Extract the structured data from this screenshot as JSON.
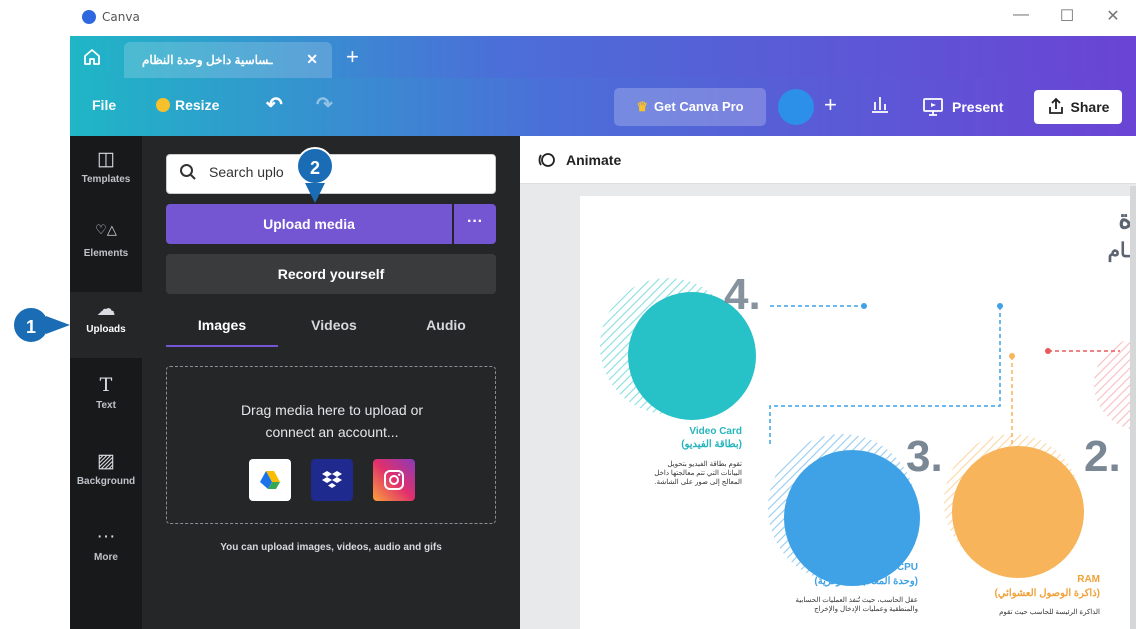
{
  "window": {
    "app_name": "Canva",
    "min": "—",
    "max": "☐",
    "close": "✕"
  },
  "tabbar": {
    "home_icon": "home-icon",
    "doc_tab_title": "ـساسية داخل وحدة النظام",
    "close": "✕",
    "new_tab": "+"
  },
  "toolbar": {
    "file": "File",
    "resize": "Resize",
    "undo": "↶",
    "redo": "↷",
    "get_pro": "Get Canva Pro",
    "add": "+",
    "insights": "ıll",
    "present_icon": "▭",
    "present": "Present",
    "share_icon": "⇧",
    "share": "Share"
  },
  "rail": {
    "items": [
      {
        "label": "Templates",
        "icon": "◫"
      },
      {
        "label": "Elements",
        "icon": "♡△"
      },
      {
        "label": "Uploads",
        "icon": "☁"
      },
      {
        "label": "Text",
        "icon": "T"
      },
      {
        "label": "Background",
        "icon": "▨"
      },
      {
        "label": "More",
        "icon": "···"
      }
    ]
  },
  "panel": {
    "search_value": "Search uplo",
    "upload_media": "Upload media",
    "upload_more": "···",
    "record": "Record yourself",
    "tabs": [
      "Images",
      "Videos",
      "Audio"
    ],
    "drop_text_1": "Drag media here to upload or",
    "drop_text_2": "connect an account...",
    "helper": "You can upload images, videos, audio and gifs",
    "services": [
      "google-drive-icon",
      "dropbox-icon",
      "instagram-icon"
    ],
    "collapse": "‹"
  },
  "canvas": {
    "animate": "Animate",
    "title_frag_1": "ة",
    "title_frag_2": "ـام",
    "items": [
      {
        "num": "4.",
        "en": "Video Card",
        "ar": "(بطاقة الفيديو)",
        "desc": "تقوم بطاقة الفيديو بتحويل البيانات التي تتم معالجتها داخل المعالج إلى صور على الشاشة."
      },
      {
        "num": "3.",
        "en": "CPU",
        "ar": "(وحدة المعالجة المركزية)",
        "desc": "عقل الحاسب، حيث تُنفذ العمليات الحسابية والمنطقية وعمليات الإدخال والإخراج"
      },
      {
        "num": "2.",
        "en": "RAM",
        "ar": "(ذاكرة الوصول العشوائي)",
        "desc": "الذاكرة الرئيسة للحاسب حيث تقوم"
      }
    ]
  },
  "annotations": [
    "1",
    "2"
  ],
  "colors": {
    "accent": "#7556d2",
    "teal": "#26c2c8",
    "blue": "#3fa2e6",
    "orange": "#f7b45a",
    "badge": "#1a6db4"
  }
}
